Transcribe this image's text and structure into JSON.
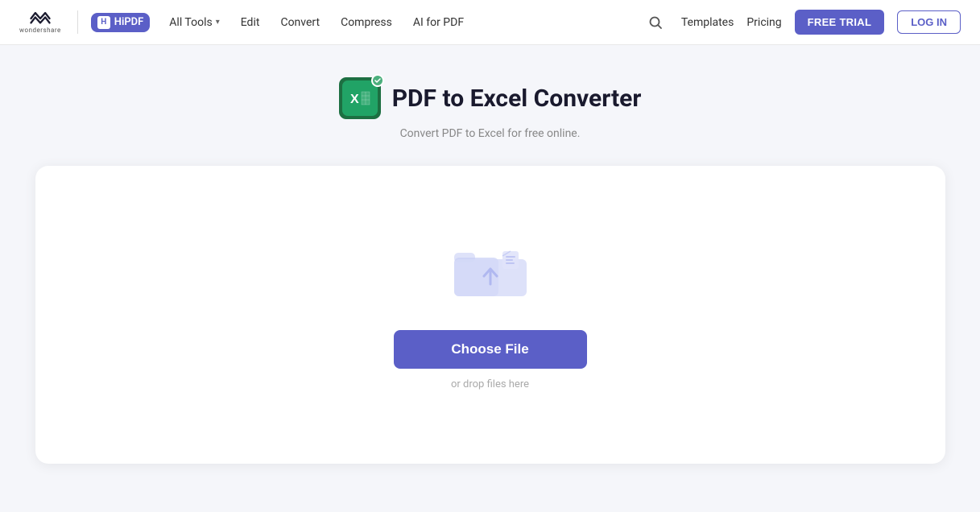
{
  "header": {
    "brand": "wondershare",
    "app_name": "HiPDF",
    "nav_items": [
      {
        "label": "All Tools",
        "has_dropdown": true
      },
      {
        "label": "Edit",
        "has_dropdown": false
      },
      {
        "label": "Convert",
        "has_dropdown": false
      },
      {
        "label": "Compress",
        "has_dropdown": false
      },
      {
        "label": "AI for PDF",
        "has_dropdown": false
      }
    ],
    "right_links": [
      {
        "label": "Templates"
      },
      {
        "label": "Pricing"
      }
    ],
    "free_trial_label": "FREE TRIAL",
    "login_label": "LOG IN"
  },
  "page": {
    "title": "PDF to Excel Converter",
    "subtitle": "Convert PDF to Excel for free online.",
    "choose_file_label": "Choose File",
    "drop_hint": "or drop files here"
  }
}
